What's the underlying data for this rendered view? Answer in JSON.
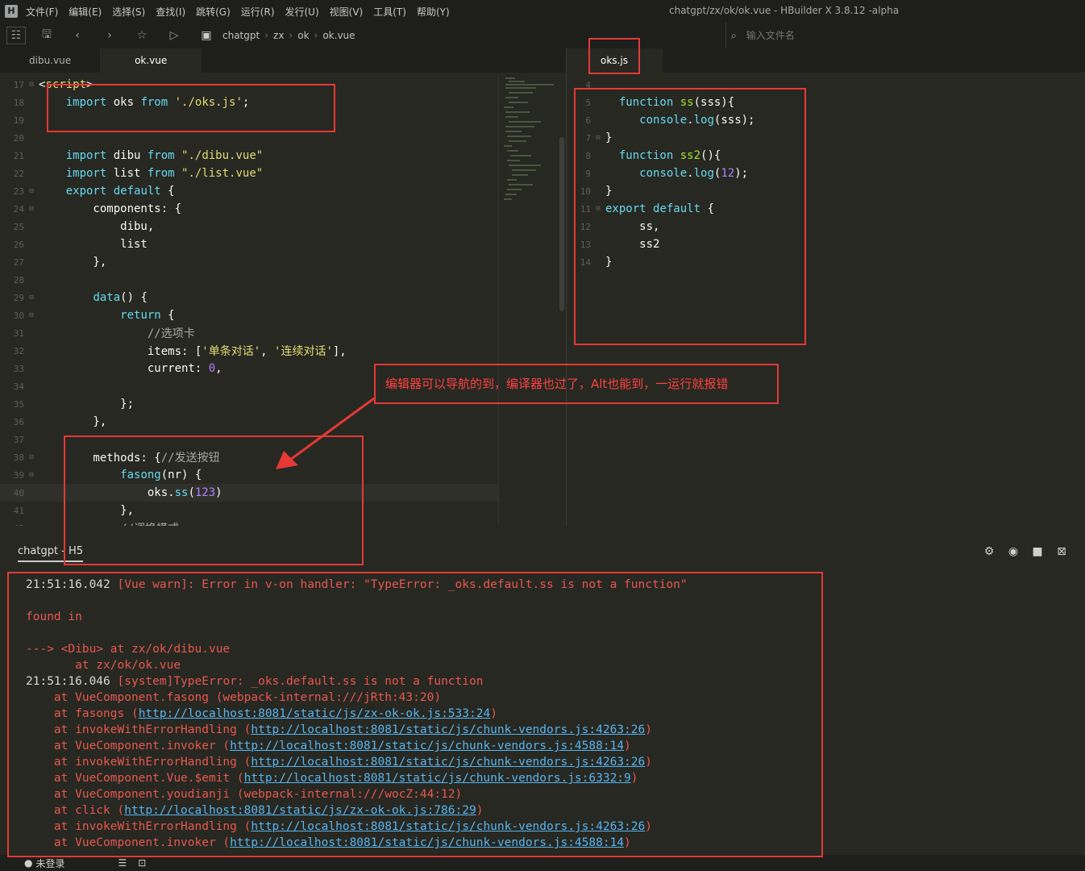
{
  "app": {
    "title": "chatgpt/zx/ok/ok.vue - HBuilder X 3.8.12 -alpha",
    "logo": "H"
  },
  "menu": [
    "文件(F)",
    "编辑(E)",
    "选择(S)",
    "查找(I)",
    "跳转(G)",
    "运行(R)",
    "发行(U)",
    "视图(V)",
    "工具(T)",
    "帮助(Y)"
  ],
  "toolbar": {
    "breadcrumb": [
      "chatgpt",
      "zx",
      "ok",
      "ok.vue"
    ],
    "file_search_placeholder": "输入文件名",
    "crumb_sep": "›",
    "icons": [
      "sidebar-toggle-icon",
      "save-icon",
      "back-icon",
      "forward-icon",
      "star-icon",
      "run-icon",
      "project-icon"
    ]
  },
  "tabs_left": [
    {
      "label": "dibu.vue",
      "active": false
    },
    {
      "label": "ok.vue",
      "active": true
    }
  ],
  "tabs_right": [
    {
      "label": "oks.js",
      "active": true
    }
  ],
  "editor_left": {
    "lines": [
      {
        "n": "17",
        "fold": true,
        "tokens": [
          [
            "plain",
            "<"
          ],
          [
            "str",
            "script"
          ],
          [
            "plain",
            ">"
          ]
        ]
      },
      {
        "n": "18",
        "tokens": [
          [
            "plain",
            "    "
          ],
          [
            "kw",
            "import"
          ],
          [
            "plain",
            " oks "
          ],
          [
            "kw",
            "from"
          ],
          [
            "plain",
            " "
          ],
          [
            "str",
            "'./oks.js'"
          ],
          [
            "plain",
            ";"
          ]
        ]
      },
      {
        "n": "19",
        "tokens": []
      },
      {
        "n": "20",
        "tokens": []
      },
      {
        "n": "21",
        "tokens": [
          [
            "plain",
            "    "
          ],
          [
            "kw",
            "import"
          ],
          [
            "plain",
            " dibu "
          ],
          [
            "kw",
            "from"
          ],
          [
            "plain",
            " "
          ],
          [
            "str",
            "\"./dibu.vue\""
          ]
        ]
      },
      {
        "n": "22",
        "tokens": [
          [
            "plain",
            "    "
          ],
          [
            "kw",
            "import"
          ],
          [
            "plain",
            " list "
          ],
          [
            "kw",
            "from"
          ],
          [
            "plain",
            " "
          ],
          [
            "str",
            "\"./list.vue\""
          ]
        ]
      },
      {
        "n": "23",
        "fold": true,
        "tokens": [
          [
            "plain",
            "    "
          ],
          [
            "kw",
            "export"
          ],
          [
            "plain",
            " "
          ],
          [
            "kw",
            "default"
          ],
          [
            "plain",
            " {"
          ]
        ]
      },
      {
        "n": "24",
        "fold": true,
        "tokens": [
          [
            "plain",
            "        components: {"
          ]
        ]
      },
      {
        "n": "25",
        "tokens": [
          [
            "plain",
            "            dibu,"
          ]
        ]
      },
      {
        "n": "26",
        "tokens": [
          [
            "plain",
            "            list"
          ]
        ]
      },
      {
        "n": "27",
        "tokens": [
          [
            "plain",
            "        },"
          ]
        ]
      },
      {
        "n": "28",
        "tokens": []
      },
      {
        "n": "29",
        "fold": true,
        "tokens": [
          [
            "plain",
            "        "
          ],
          [
            "kw",
            "data"
          ],
          [
            "plain",
            "() {"
          ]
        ]
      },
      {
        "n": "30",
        "fold": true,
        "tokens": [
          [
            "plain",
            "            "
          ],
          [
            "kw",
            "return"
          ],
          [
            "plain",
            " {"
          ]
        ]
      },
      {
        "n": "31",
        "tokens": [
          [
            "plain",
            "                "
          ],
          [
            "cmt",
            "//选项卡"
          ]
        ]
      },
      {
        "n": "32",
        "tokens": [
          [
            "plain",
            "                items: ["
          ],
          [
            "str",
            "'单条对话'"
          ],
          [
            "plain",
            ", "
          ],
          [
            "str",
            "'连续对话'"
          ],
          [
            "plain",
            "],"
          ]
        ]
      },
      {
        "n": "33",
        "tokens": [
          [
            "plain",
            "                current: "
          ],
          [
            "num",
            "0"
          ],
          [
            "plain",
            ","
          ]
        ]
      },
      {
        "n": "34",
        "tokens": []
      },
      {
        "n": "35",
        "tokens": [
          [
            "plain",
            "            };"
          ]
        ]
      },
      {
        "n": "36",
        "tokens": [
          [
            "plain",
            "        },"
          ]
        ]
      },
      {
        "n": "37",
        "tokens": []
      },
      {
        "n": "38",
        "fold": true,
        "tokens": [
          [
            "plain",
            "        methods: {"
          ],
          [
            "cmt",
            "//发送按钮"
          ]
        ]
      },
      {
        "n": "39",
        "fold": true,
        "tokens": [
          [
            "plain",
            "            "
          ],
          [
            "kw",
            "fasong"
          ],
          [
            "plain",
            "(nr) {"
          ]
        ]
      },
      {
        "n": "40",
        "hl": true,
        "tokens": [
          [
            "plain",
            "                oks."
          ],
          [
            "kw",
            "ss"
          ],
          [
            "plain",
            "("
          ],
          [
            "num",
            "123"
          ],
          [
            "plain",
            ")"
          ]
        ]
      },
      {
        "n": "41",
        "tokens": [
          [
            "plain",
            "            },"
          ]
        ]
      },
      {
        "n": "42",
        "tokens": [
          [
            "cmt",
            "            //调换模式"
          ]
        ]
      }
    ]
  },
  "editor_right": {
    "lines": [
      {
        "n": "4",
        "tokens": []
      },
      {
        "n": "5",
        "tokens": [
          [
            "plain",
            "  "
          ],
          [
            "kw",
            "function"
          ],
          [
            "plain",
            " "
          ],
          [
            "prop",
            "ss"
          ],
          [
            "plain",
            "(sss){"
          ]
        ]
      },
      {
        "n": "6",
        "tokens": [
          [
            "plain",
            "     "
          ],
          [
            "kw",
            "console"
          ],
          [
            "plain",
            "."
          ],
          [
            "kw",
            "log"
          ],
          [
            "plain",
            "(sss);"
          ]
        ]
      },
      {
        "n": "7",
        "fold": true,
        "tokens": [
          [
            "plain",
            "}"
          ]
        ]
      },
      {
        "n": "8",
        "tokens": [
          [
            "plain",
            "  "
          ],
          [
            "kw",
            "function"
          ],
          [
            "plain",
            " "
          ],
          [
            "prop",
            "ss2"
          ],
          [
            "plain",
            "(){"
          ]
        ]
      },
      {
        "n": "9",
        "tokens": [
          [
            "plain",
            "     "
          ],
          [
            "kw",
            "console"
          ],
          [
            "plain",
            "."
          ],
          [
            "kw",
            "log"
          ],
          [
            "plain",
            "("
          ],
          [
            "num",
            "12"
          ],
          [
            "plain",
            ");"
          ]
        ]
      },
      {
        "n": "10",
        "tokens": [
          [
            "plain",
            "}"
          ]
        ]
      },
      {
        "n": "11",
        "fold": true,
        "tokens": [
          [
            "kw",
            "export"
          ],
          [
            "plain",
            " "
          ],
          [
            "kw",
            "default"
          ],
          [
            "plain",
            " {"
          ]
        ]
      },
      {
        "n": "12",
        "tokens": [
          [
            "plain",
            "     ss,"
          ]
        ]
      },
      {
        "n": "13",
        "tokens": [
          [
            "plain",
            "     ss2"
          ]
        ]
      },
      {
        "n": "14",
        "tokens": [
          [
            "plain",
            "}"
          ]
        ]
      }
    ]
  },
  "annotation": "编辑器可以导航的到，编译器也过了，Alt也能到，一运行就报错",
  "panel": {
    "tab": "chatgpt - H5",
    "icons": [
      "debug-icon",
      "run-config-icon",
      "stop-icon",
      "clear-console-icon"
    ]
  },
  "console": {
    "lines": [
      [
        [
          "ts",
          "21:51:16.042 "
        ],
        [
          "err",
          "[Vue warn]: Error in v-on handler: \"TypeError: _oks.default.ss is not a function\""
        ]
      ],
      [],
      [
        [
          "err",
          "found in"
        ]
      ],
      [],
      [
        [
          "err",
          "---> <Dibu> at zx/ok/dibu.vue"
        ]
      ],
      [
        [
          "err",
          "       at zx/ok/ok.vue"
        ]
      ],
      [
        [
          "ts",
          "21:51:16.046 "
        ],
        [
          "err",
          "[system]TypeError: _oks.default.ss is not a function"
        ]
      ],
      [
        [
          "err",
          "    at VueComponent.fasong (webpack-internal:///jRth:43:20)"
        ]
      ],
      [
        [
          "err",
          "    at fasongs ("
        ],
        [
          "lnk",
          "http://localhost:8081/static/js/zx-ok-ok.js:533:24"
        ],
        [
          "err",
          ")"
        ]
      ],
      [
        [
          "err",
          "    at invokeWithErrorHandling ("
        ],
        [
          "lnk",
          "http://localhost:8081/static/js/chunk-vendors.js:4263:26"
        ],
        [
          "err",
          ")"
        ]
      ],
      [
        [
          "err",
          "    at VueComponent.invoker ("
        ],
        [
          "lnk",
          "http://localhost:8081/static/js/chunk-vendors.js:4588:14"
        ],
        [
          "err",
          ")"
        ]
      ],
      [
        [
          "err",
          "    at invokeWithErrorHandling ("
        ],
        [
          "lnk",
          "http://localhost:8081/static/js/chunk-vendors.js:4263:26"
        ],
        [
          "err",
          ")"
        ]
      ],
      [
        [
          "err",
          "    at VueComponent.Vue.$emit ("
        ],
        [
          "lnk",
          "http://localhost:8081/static/js/chunk-vendors.js:6332:9"
        ],
        [
          "err",
          ")"
        ]
      ],
      [
        [
          "err",
          "    at VueComponent.youdianji (webpack-internal:///wocZ:44:12)"
        ]
      ],
      [
        [
          "err",
          "    at click ("
        ],
        [
          "lnk",
          "http://localhost:8081/static/js/zx-ok-ok.js:786:29"
        ],
        [
          "err",
          ")"
        ]
      ],
      [
        [
          "err",
          "    at invokeWithErrorHandling ("
        ],
        [
          "lnk",
          "http://localhost:8081/static/js/chunk-vendors.js:4263:26"
        ],
        [
          "err",
          ")"
        ]
      ],
      [
        [
          "err",
          "    at VueComponent.invoker ("
        ],
        [
          "lnk",
          "http://localhost:8081/static/js/chunk-vendors.js:4588:14"
        ],
        [
          "err",
          ")"
        ]
      ]
    ]
  },
  "status": {
    "user": "未登录"
  },
  "colors": {
    "annotation_red": "#e53935",
    "error": "#e8574f",
    "link": "#58b4f0",
    "bg": "#272822"
  }
}
